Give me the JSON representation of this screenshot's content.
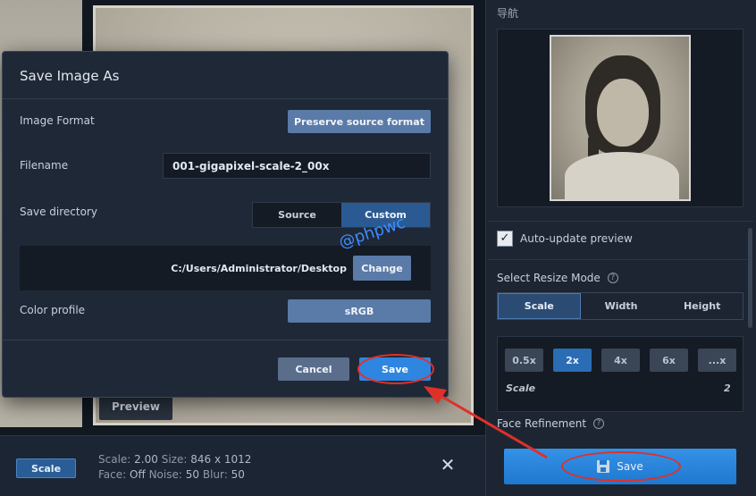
{
  "dialog": {
    "title": "Save Image As",
    "image_format_label": "Image Format",
    "image_format_value": "Preserve source format",
    "filename_label": "Filename",
    "filename_value": "001-gigapixel-scale-2_00x",
    "save_directory_label": "Save directory",
    "directory_options": [
      "Source",
      "Custom"
    ],
    "directory_selected": "Custom",
    "path": "C:/Users/Administrator/Desktop",
    "change_label": "Change",
    "color_profile_label": "Color profile",
    "color_profile_value": "sRGB",
    "cancel_label": "Cancel",
    "save_label": "Save"
  },
  "workspace": {
    "preview_label": "Preview"
  },
  "bottombar": {
    "mode_chip": "Scale",
    "scale_text": "Scale:",
    "scale_value": "2.00",
    "size_text": "Size:",
    "size_value": "846 x 1012",
    "face_text": "Face:",
    "face_value": "Off",
    "noise_text": "Noise:",
    "noise_value": "50",
    "blur_text": "Blur:",
    "blur_value": "50",
    "close_glyph": "✕"
  },
  "rightpanel": {
    "nav_title": "导航",
    "auto_update_label": "Auto-update preview",
    "auto_update_checked": true,
    "resize_mode_title": "Select Resize Mode",
    "resize_modes": [
      "Scale",
      "Width",
      "Height"
    ],
    "resize_mode_selected": "Scale",
    "scale_options": [
      "0.5x",
      "2x",
      "4x",
      "6x",
      "...x"
    ],
    "scale_selected": "2x",
    "scale_label": "Scale",
    "scale_value": "2",
    "face_refinement_label": "Face Refinement",
    "save_label": "Save"
  },
  "watermark": "@phpwc",
  "colors": {
    "accent": "#2f86e0",
    "annotation": "#e0302a"
  }
}
